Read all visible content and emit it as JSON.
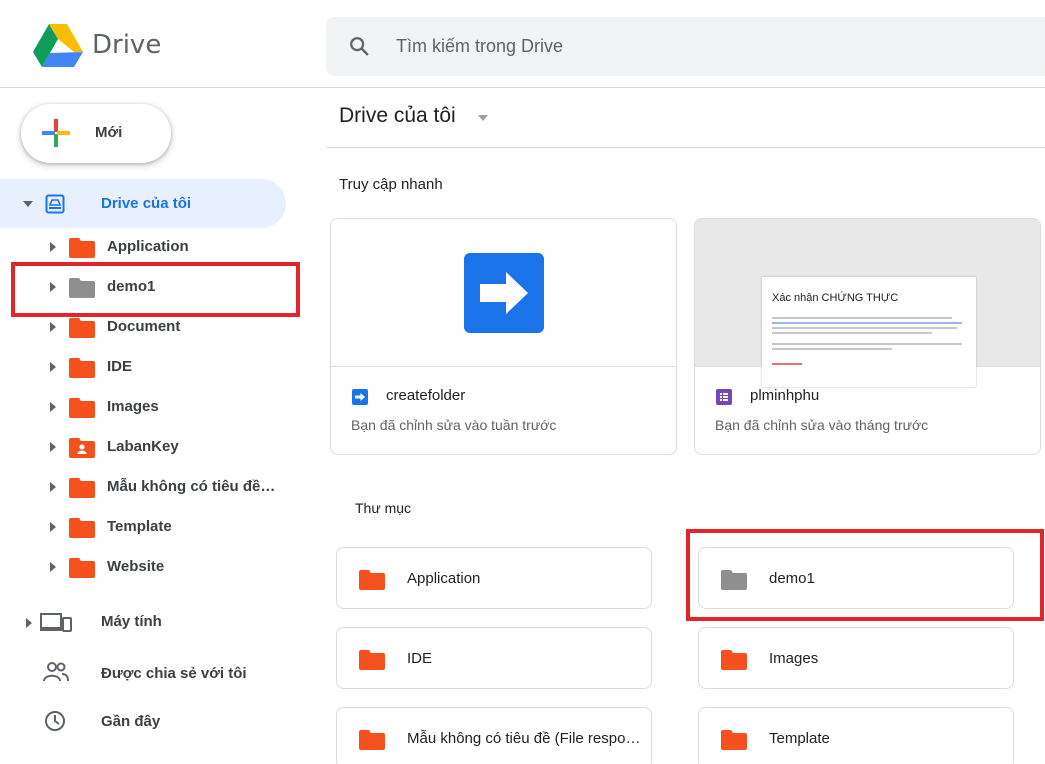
{
  "header": {
    "brand": "Drive",
    "search_placeholder": "Tìm kiếm trong Drive"
  },
  "sidebar": {
    "new_label": "Mới",
    "my_drive": "Drive của tôi",
    "tree": [
      {
        "label": "Application",
        "color": "#f4511e",
        "icon": "folder-icon"
      },
      {
        "label": "demo1",
        "color": "#8f8f8f",
        "icon": "folder-icon"
      },
      {
        "label": "Document",
        "color": "#f4511e",
        "icon": "folder-icon"
      },
      {
        "label": "IDE",
        "color": "#f4511e",
        "icon": "folder-icon"
      },
      {
        "label": "Images",
        "color": "#f4511e",
        "icon": "folder-icon"
      },
      {
        "label": "LabanKey",
        "color": "#f4511e",
        "icon": "shared-folder-icon"
      },
      {
        "label": "Mẫu không có tiêu đề…",
        "color": "#f4511e",
        "icon": "folder-icon"
      },
      {
        "label": "Template",
        "color": "#f4511e",
        "icon": "folder-icon"
      },
      {
        "label": "Website",
        "color": "#f4511e",
        "icon": "folder-icon"
      }
    ],
    "computers": "Máy tính",
    "shared": "Được chia sẻ với tôi",
    "recent": "Gần đây"
  },
  "main": {
    "title": "Drive của tôi",
    "quick_access_label": "Truy cập nhanh",
    "quick_access": [
      {
        "name": "createfolder",
        "sub": "Bạn đã chỉnh sửa vào tuần trước",
        "icon": "apps-script-icon"
      },
      {
        "name": "plminhphu",
        "sub": "Bạn đã chỉnh sửa vào tháng trước",
        "icon": "forms-icon",
        "preview_title": "Xác nhận CHỨNG THỰC"
      }
    ],
    "folders_label": "Thư mục",
    "folders": [
      {
        "name": "Application",
        "color": "#f4511e"
      },
      {
        "name": "demo1",
        "color": "#8f8f8f"
      },
      {
        "name": "IDE",
        "color": "#f4511e"
      },
      {
        "name": "Images",
        "color": "#f4511e"
      },
      {
        "name": "Mẫu không có tiêu đề (File respo…",
        "color": "#f4511e"
      },
      {
        "name": "Template",
        "color": "#f4511e"
      }
    ]
  },
  "colors": {
    "accent_blue": "#1a73e8",
    "folder_red": "#f4511e",
    "folder_grey": "#8f8f8f",
    "highlight_red": "#e3242b",
    "forms_purple": "#7248b9"
  }
}
